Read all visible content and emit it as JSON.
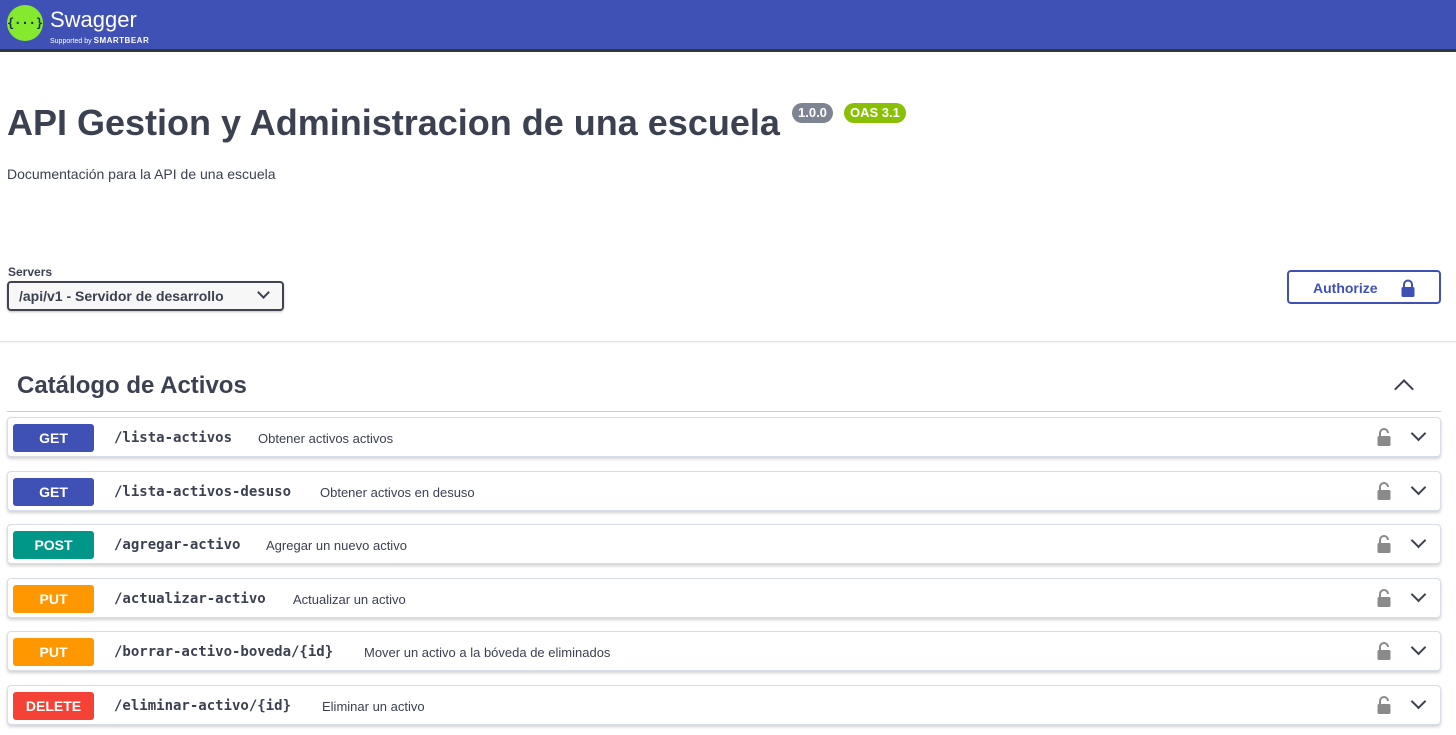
{
  "topbar": {
    "logo_glyph": "{···}",
    "brand": "Swagger",
    "supported_by": "Supported by",
    "company": "SMARTBEAR"
  },
  "info": {
    "title": "API Gestion y Administracion de una escuela",
    "version": "1.0.0",
    "oas": "OAS 3.1",
    "description": "Documentación para la API de una escuela"
  },
  "servers": {
    "label": "Servers",
    "selected": "/api/v1 - Servidor de desarrollo"
  },
  "authorize": {
    "label": "Authorize",
    "icon": "lock-icon"
  },
  "tag": {
    "name": "Catálogo de Activos",
    "expanded": true
  },
  "operations": [
    {
      "method": "GET",
      "path": "/lista-activos",
      "summary": "Obtener activos activos"
    },
    {
      "method": "GET",
      "path": "/lista-activos-desuso",
      "summary": "Obtener activos en desuso"
    },
    {
      "method": "POST",
      "path": "/agregar-activo",
      "summary": "Agregar un nuevo activo"
    },
    {
      "method": "PUT",
      "path": "/actualizar-activo",
      "summary": "Actualizar un activo"
    },
    {
      "method": "PUT",
      "path": "/borrar-activo-boveda/{id}",
      "summary": "Mover un activo a la bóveda de eliminados"
    },
    {
      "method": "DELETE",
      "path": "/eliminar-activo/{id}",
      "summary": "Eliminar un activo"
    }
  ],
  "colors": {
    "topbar": "#3f51b5",
    "get": "#3f51b5",
    "post": "#009688",
    "put": "#ff9800",
    "delete": "#f44336",
    "version_badge": "#7d8492",
    "oas_badge": "#89bf04"
  }
}
